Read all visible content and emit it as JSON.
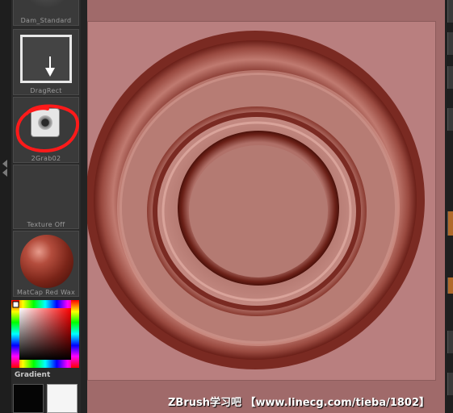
{
  "brushes": [
    {
      "label": "Dam_Standard"
    },
    {
      "label": "DragRect"
    },
    {
      "label": "2Grab02"
    }
  ],
  "texture": {
    "label": "Texture Off"
  },
  "material": {
    "label": "MatCap Red Wax"
  },
  "color": {
    "gradient_label": "Gradient",
    "main_color": "#ffffff",
    "secondary_color": "#000000"
  },
  "canvas": {
    "background": "#b97f7f"
  },
  "watermark": {
    "text": "ZBrush学习吧  【www.linecg.com/tieba/1802】"
  },
  "annotation": {
    "color": "#ff1a1a"
  }
}
